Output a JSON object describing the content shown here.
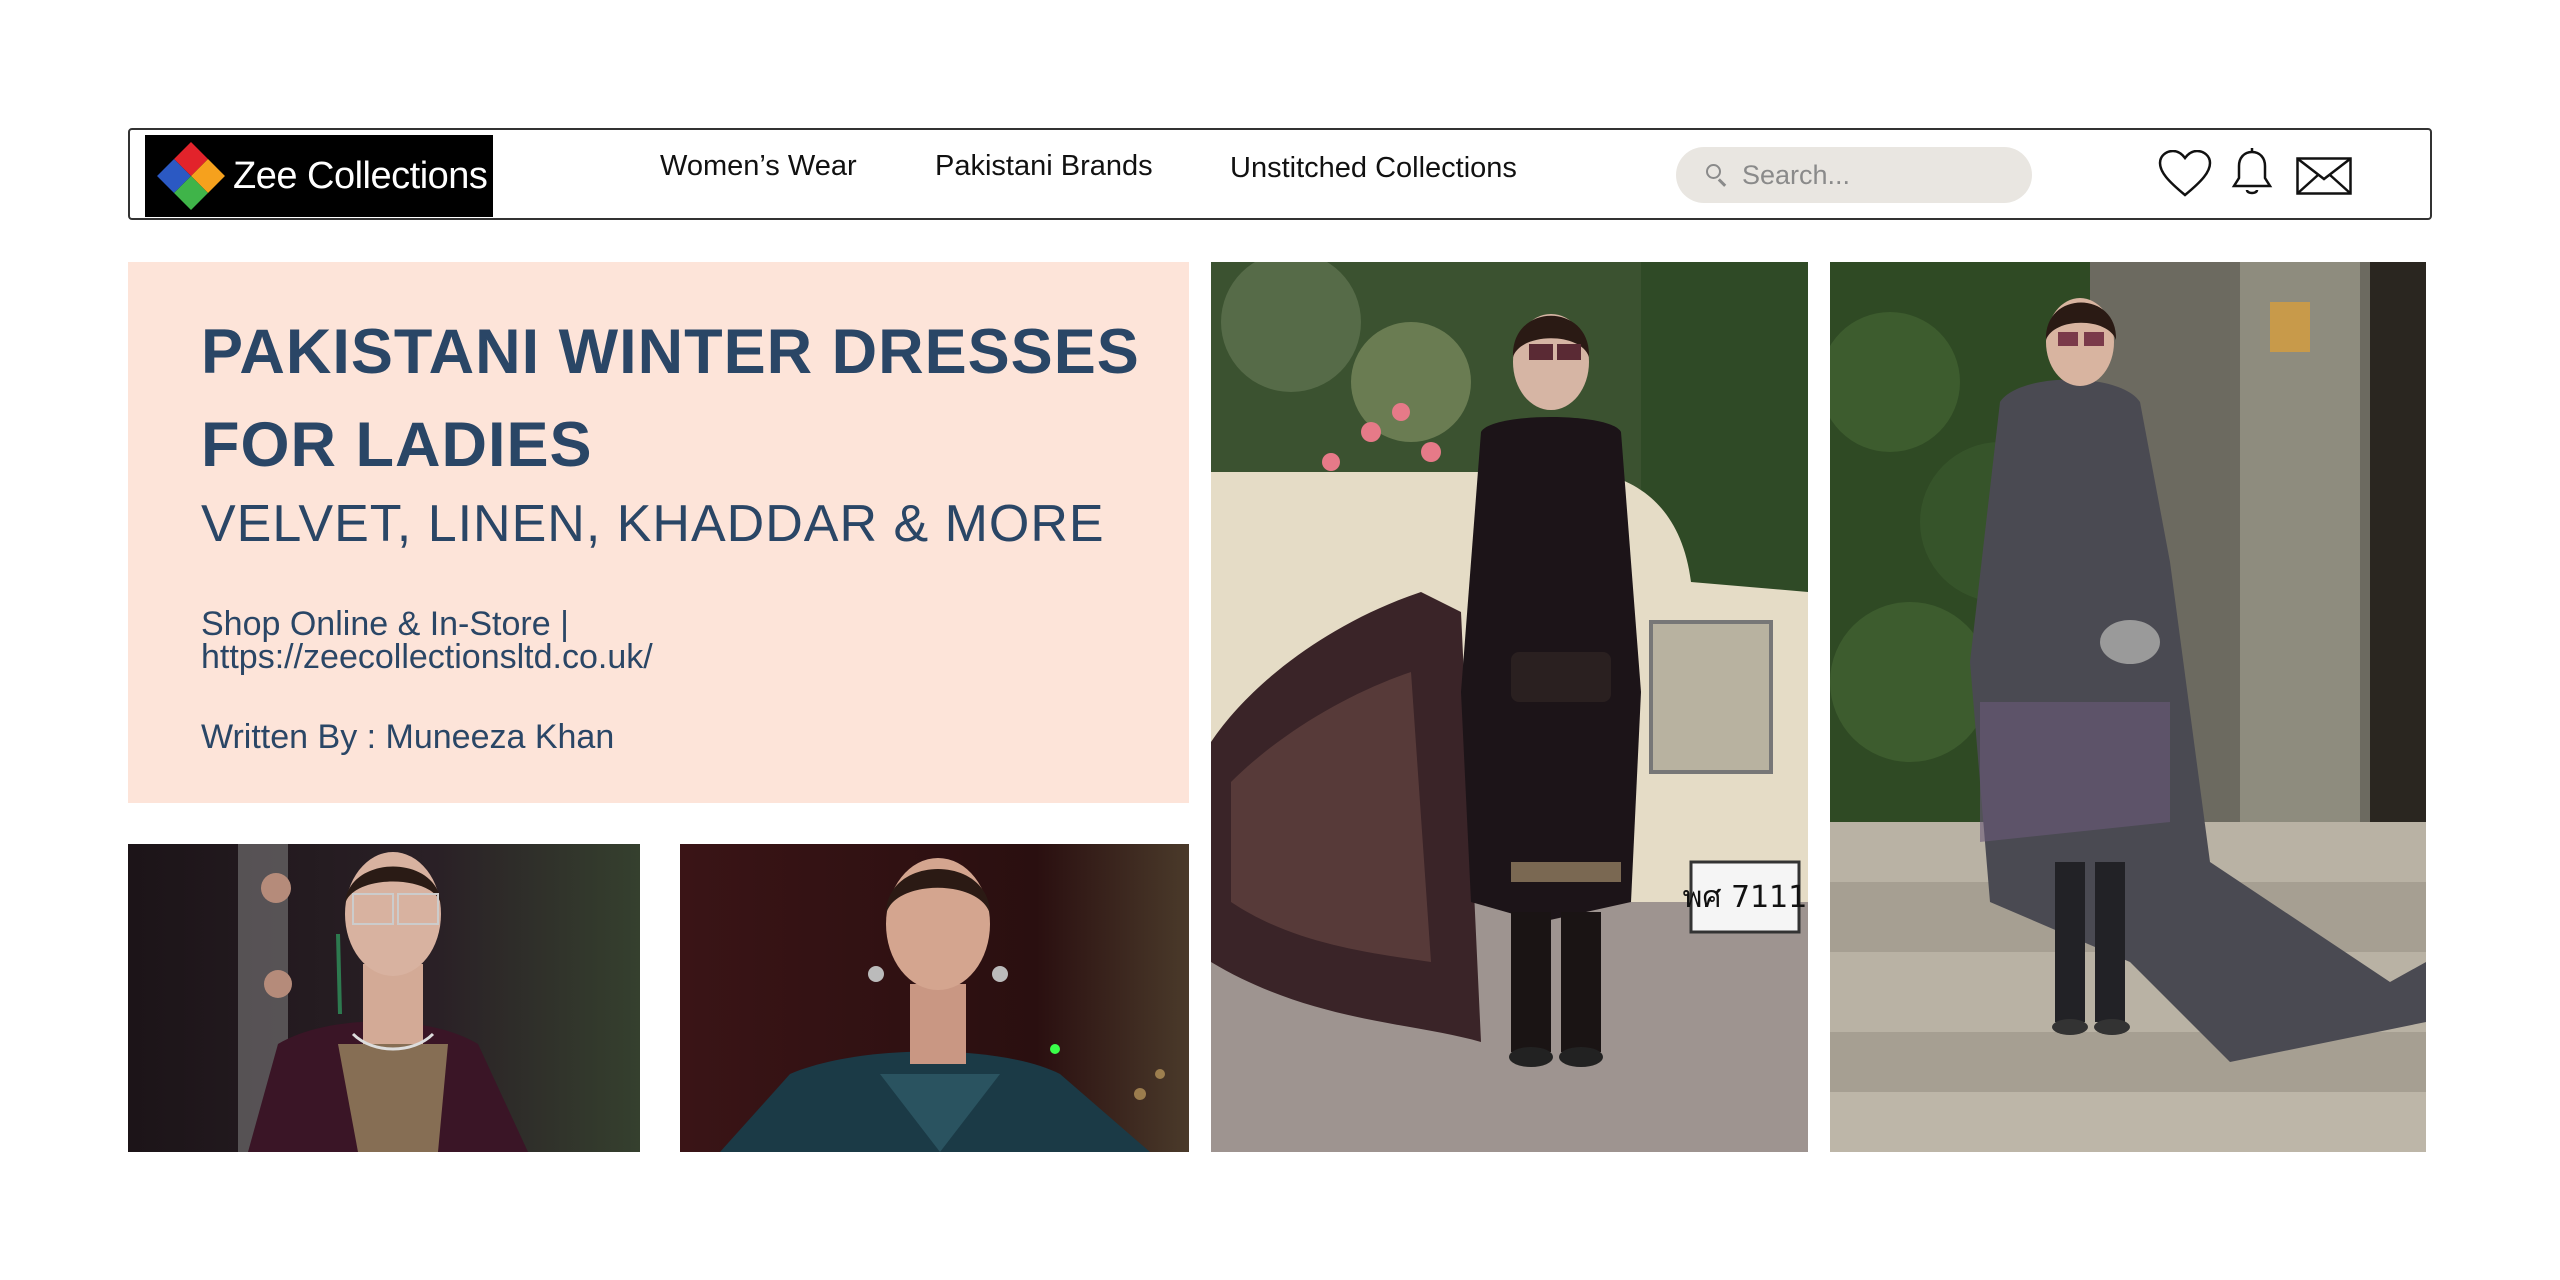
{
  "brand": {
    "name": "Zee Collections"
  },
  "nav": {
    "links": [
      "Women’s Wear",
      "Pakistani Brands",
      "Unstitched Collections"
    ]
  },
  "search": {
    "placeholder": "Search..."
  },
  "icons": [
    "heart-icon",
    "bell-icon",
    "mail-icon"
  ],
  "hero": {
    "title": "PAKISTANI WINTER DRESSES FOR LADIES",
    "subtitle": "VELVET, LINEN, KHADDAR & MORE",
    "shop_line": "Shop Online & In-Store | https://zeecollectionsltd.co.uk/",
    "author": "Written By : Muneeza Khan"
  },
  "photos": {
    "car_plate": "พศ 7111"
  },
  "colors": {
    "hero_bg": "#fde4d9",
    "hero_text": "#2a4666",
    "search_bg": "#e9e6e1",
    "logo_bg": "#000000"
  }
}
